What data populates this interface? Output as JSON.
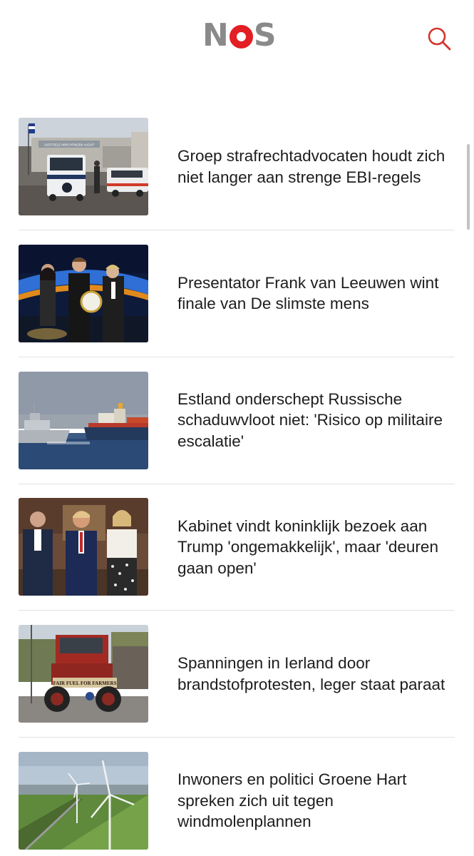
{
  "header": {
    "logo": {
      "n": "N",
      "o": "O",
      "s": "S"
    },
    "search_icon": "magnifier-icon"
  },
  "colors": {
    "brand_red": "#e31e24",
    "logo_gray": "#8a8a8a",
    "text": "#1d1d1d",
    "divider": "#e2e2e2"
  },
  "articles": [
    {
      "title": "Groep strafrechtadvocaten houdt zich niet langer aan strenge EBI-regels",
      "image": "prison-gate-photo"
    },
    {
      "title": "Presentator Frank van Leeuwen wint finale van De slimste mens",
      "image": "tv-show-winners-photo"
    },
    {
      "title": "Estland onderschept Russische schaduwvloot niet: 'Risico op militaire escalatie'",
      "image": "ships-at-sea-photo"
    },
    {
      "title": "Kabinet vindt koninklijk bezoek aan Trump 'ongemakkelijk', maar 'deuren gaan open'",
      "image": "royal-visit-photo"
    },
    {
      "title": "Spanningen in Ierland door brandstofprotesten, leger staat paraat",
      "image": "tractor-protest-photo"
    },
    {
      "title": "Inwoners en politici Groene Hart spreken zich uit tegen windmolenplannen",
      "image": "wind-turbines-photo"
    }
  ],
  "thumb_texts": {
    "prison_sign": "JUSTITIELE INRICHTINGEN VUGHT",
    "tractor_banner": "FAIR FUEL FOR FARMERS"
  }
}
